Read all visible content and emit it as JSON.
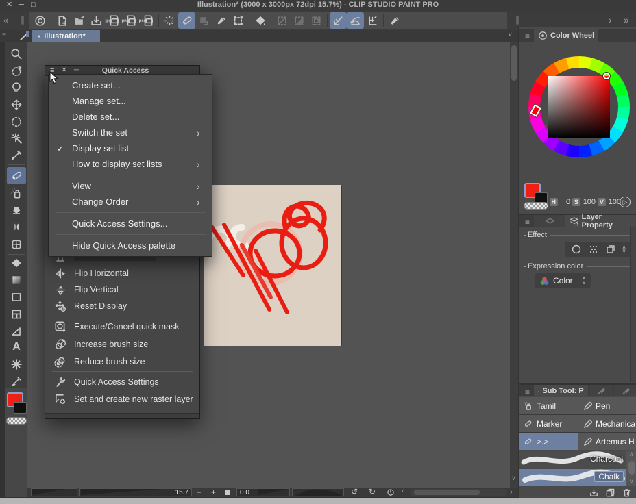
{
  "window": {
    "title": "Illustration* (3000 x 3000px 72dpi 15.7%)  - CLIP STUDIO PAINT PRO"
  },
  "icons": {
    "close": "✕",
    "minimize": "─",
    "maximize": "□",
    "collapse_left": "«",
    "handle": "∥",
    "chevron_right": "›",
    "chevrons_right": "»",
    "chevron_left": "‹",
    "menu": "≡",
    "check": "✓",
    "scroll_up": "∧",
    "scroll_down": "∨",
    "spin": "⌄",
    "dot": "●",
    "play": "▷",
    "undo": "↺",
    "redo": "↻",
    "text_tool": "A"
  },
  "toolbar": {
    "export_jpg": "jpg",
    "export_png": "png",
    "export_psd": "psd"
  },
  "canvas": {
    "tab_label": "Illustration*"
  },
  "quick_access": {
    "title": "Quick Access",
    "menu_items": [
      {
        "label": "Create set...",
        "type": "plain"
      },
      {
        "label": "Manage set...",
        "type": "plain"
      },
      {
        "label": "Delete set...",
        "type": "plain"
      },
      {
        "label": "Switch the set",
        "type": "submenu"
      },
      {
        "label": "Display set list",
        "type": "checked"
      },
      {
        "label": "How to display set lists",
        "type": "submenu"
      },
      {
        "label": "View",
        "type": "submenu"
      },
      {
        "label": "Change Order",
        "type": "submenu"
      },
      {
        "label": "Quick Access Settings...",
        "type": "plain"
      },
      {
        "label": "Hide Quick Access palette",
        "type": "plain"
      }
    ],
    "list_items": [
      "Flip Horizontal",
      "Flip Vertical",
      "Reset Display",
      "Execute/Cancel quick mask",
      "Increase brush size",
      "Reduce brush size",
      "Quick Access Settings",
      "Set and create new raster layer"
    ]
  },
  "color_wheel": {
    "title": "Color Wheel",
    "h_label": "H",
    "h_value": "0",
    "s_label": "S",
    "s_value": "100",
    "v_label": "V",
    "v_value": "100"
  },
  "layer_property": {
    "title": "Layer Property",
    "effect_label": "Effect",
    "expression_label": "Expression color",
    "expression_value": "Color"
  },
  "sub_tool": {
    "title": "Sub Tool: P",
    "tools": [
      "Tamil",
      "Pen",
      "Marker",
      "Mechanica",
      ">.>",
      "Artemus H"
    ],
    "brushes": [
      "Charcoal",
      "Chalk"
    ]
  },
  "status_bar": {
    "zoom_value": "15.7",
    "rotate_value": "0.0"
  },
  "colors": {
    "accent_blue": "#6e80a2",
    "canvas_paper": "#ddd1c4",
    "stroke_red": "#e82318"
  }
}
